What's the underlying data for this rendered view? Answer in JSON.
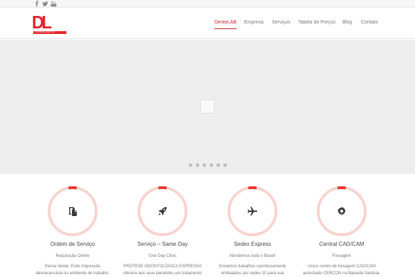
{
  "topbar": {
    "social": [
      {
        "icon": "facebook-icon"
      },
      {
        "icon": "twitter-icon"
      },
      {
        "icon": "youtube-icon"
      }
    ]
  },
  "header": {
    "logo": {
      "letters": "DL",
      "bar_text": "PRÓTESE DENTAL",
      "color": "#e4242c"
    },
    "nav": [
      {
        "label": "DenteLAB",
        "active": true
      },
      {
        "label": "Empresa",
        "active": false
      },
      {
        "label": "Serviços",
        "active": false
      },
      {
        "label": "Tabela de Preços",
        "active": false
      },
      {
        "label": "Blog",
        "active": false
      },
      {
        "label": "Contato",
        "active": false
      }
    ],
    "accent_color": "#c8242b"
  },
  "slider": {
    "background": "#eeeeee",
    "dots_count": 6
  },
  "features": [
    {
      "icon": "document-copy-icon",
      "title": "Ordem de Serviço",
      "subtitle": "Requisição Online",
      "desc_line1": "Pense Verde. Evite  impressão",
      "desc_line2": "desnecessária no ambiente de trabalho."
    },
    {
      "icon": "rocket-icon",
      "title": "Serviço – Same Day",
      "subtitle": "One Day Clinic",
      "desc_line1": "PRÓTESE ODONTOLÓGICA EXPRESSA",
      "desc_line2": "oferece aos seus pacientes um tratamento"
    },
    {
      "icon": "airplane-icon",
      "title": "Sedex Express",
      "subtitle": "Atendemos todo o Brasil!",
      "desc_line1": "Enviamos trabalhos carinhosamente",
      "desc_line2": "embalados por sedex 10 para sua"
    },
    {
      "icon": "gear-icon",
      "title": "Central CAD/CAM",
      "subtitle": "Fresagem",
      "desc_line1": "Unico centro de fresagem CAD/CAM",
      "desc_line2": "autorizado CERCON na Baixada Santista."
    }
  ],
  "ring_colors": {
    "track": "#f7d3cf",
    "accent": "#e8352d"
  }
}
